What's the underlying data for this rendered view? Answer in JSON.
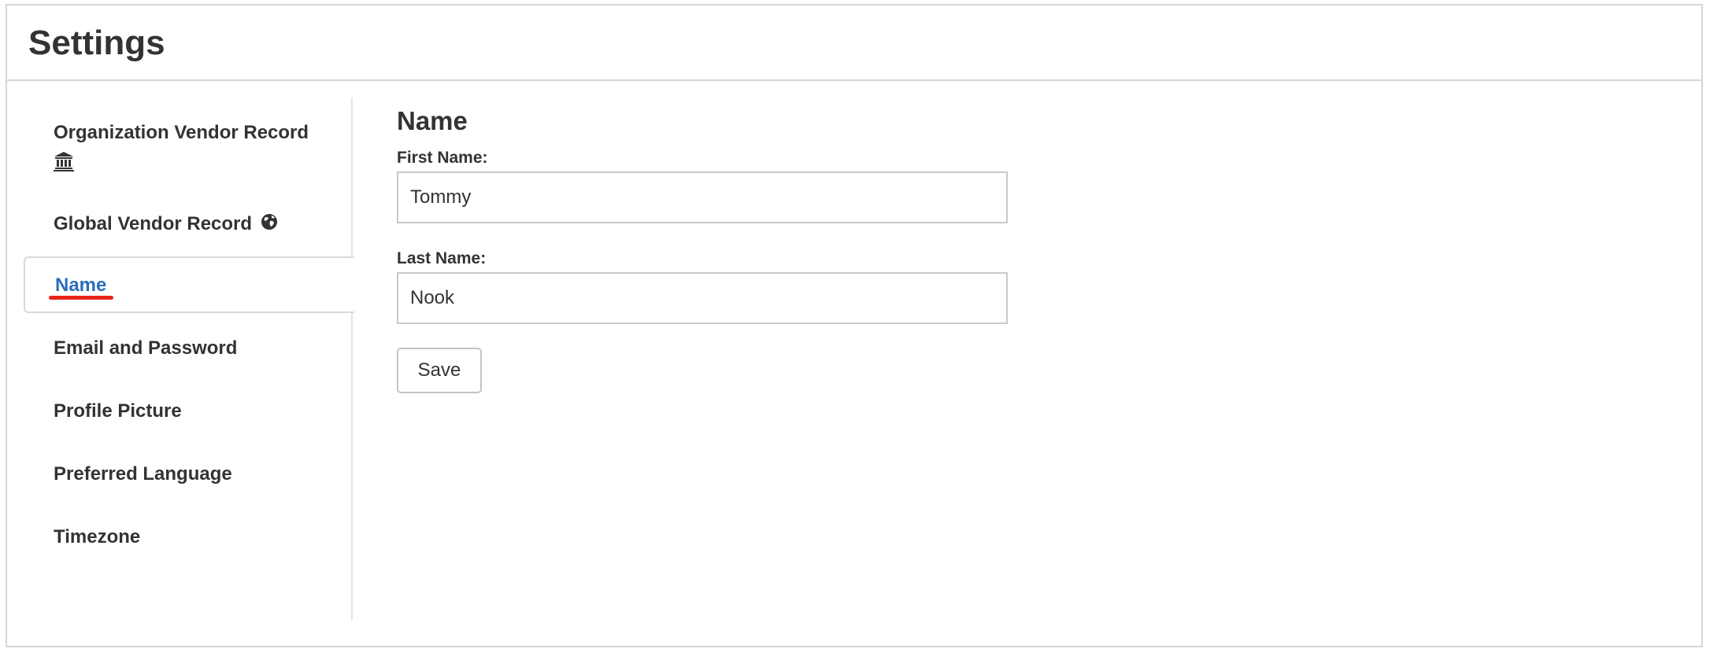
{
  "header": {
    "title": "Settings"
  },
  "sidebar": {
    "items": [
      {
        "label": "Organization Vendor Record",
        "icon": "bank-icon"
      },
      {
        "label": "Global Vendor Record",
        "icon": "globe-icon"
      },
      {
        "label": "Name",
        "active": true
      },
      {
        "label": "Email and Password"
      },
      {
        "label": "Profile Picture"
      },
      {
        "label": "Preferred Language"
      },
      {
        "label": "Timezone"
      }
    ]
  },
  "main": {
    "section_title": "Name",
    "first_name": {
      "label": "First Name:",
      "value": "Tommy"
    },
    "last_name": {
      "label": "Last Name:",
      "value": "Nook"
    },
    "save_label": "Save"
  },
  "colors": {
    "active_link": "#2a6ebb",
    "active_underline": "#e8221b",
    "text": "#333333",
    "border": "#d6d6d6"
  }
}
